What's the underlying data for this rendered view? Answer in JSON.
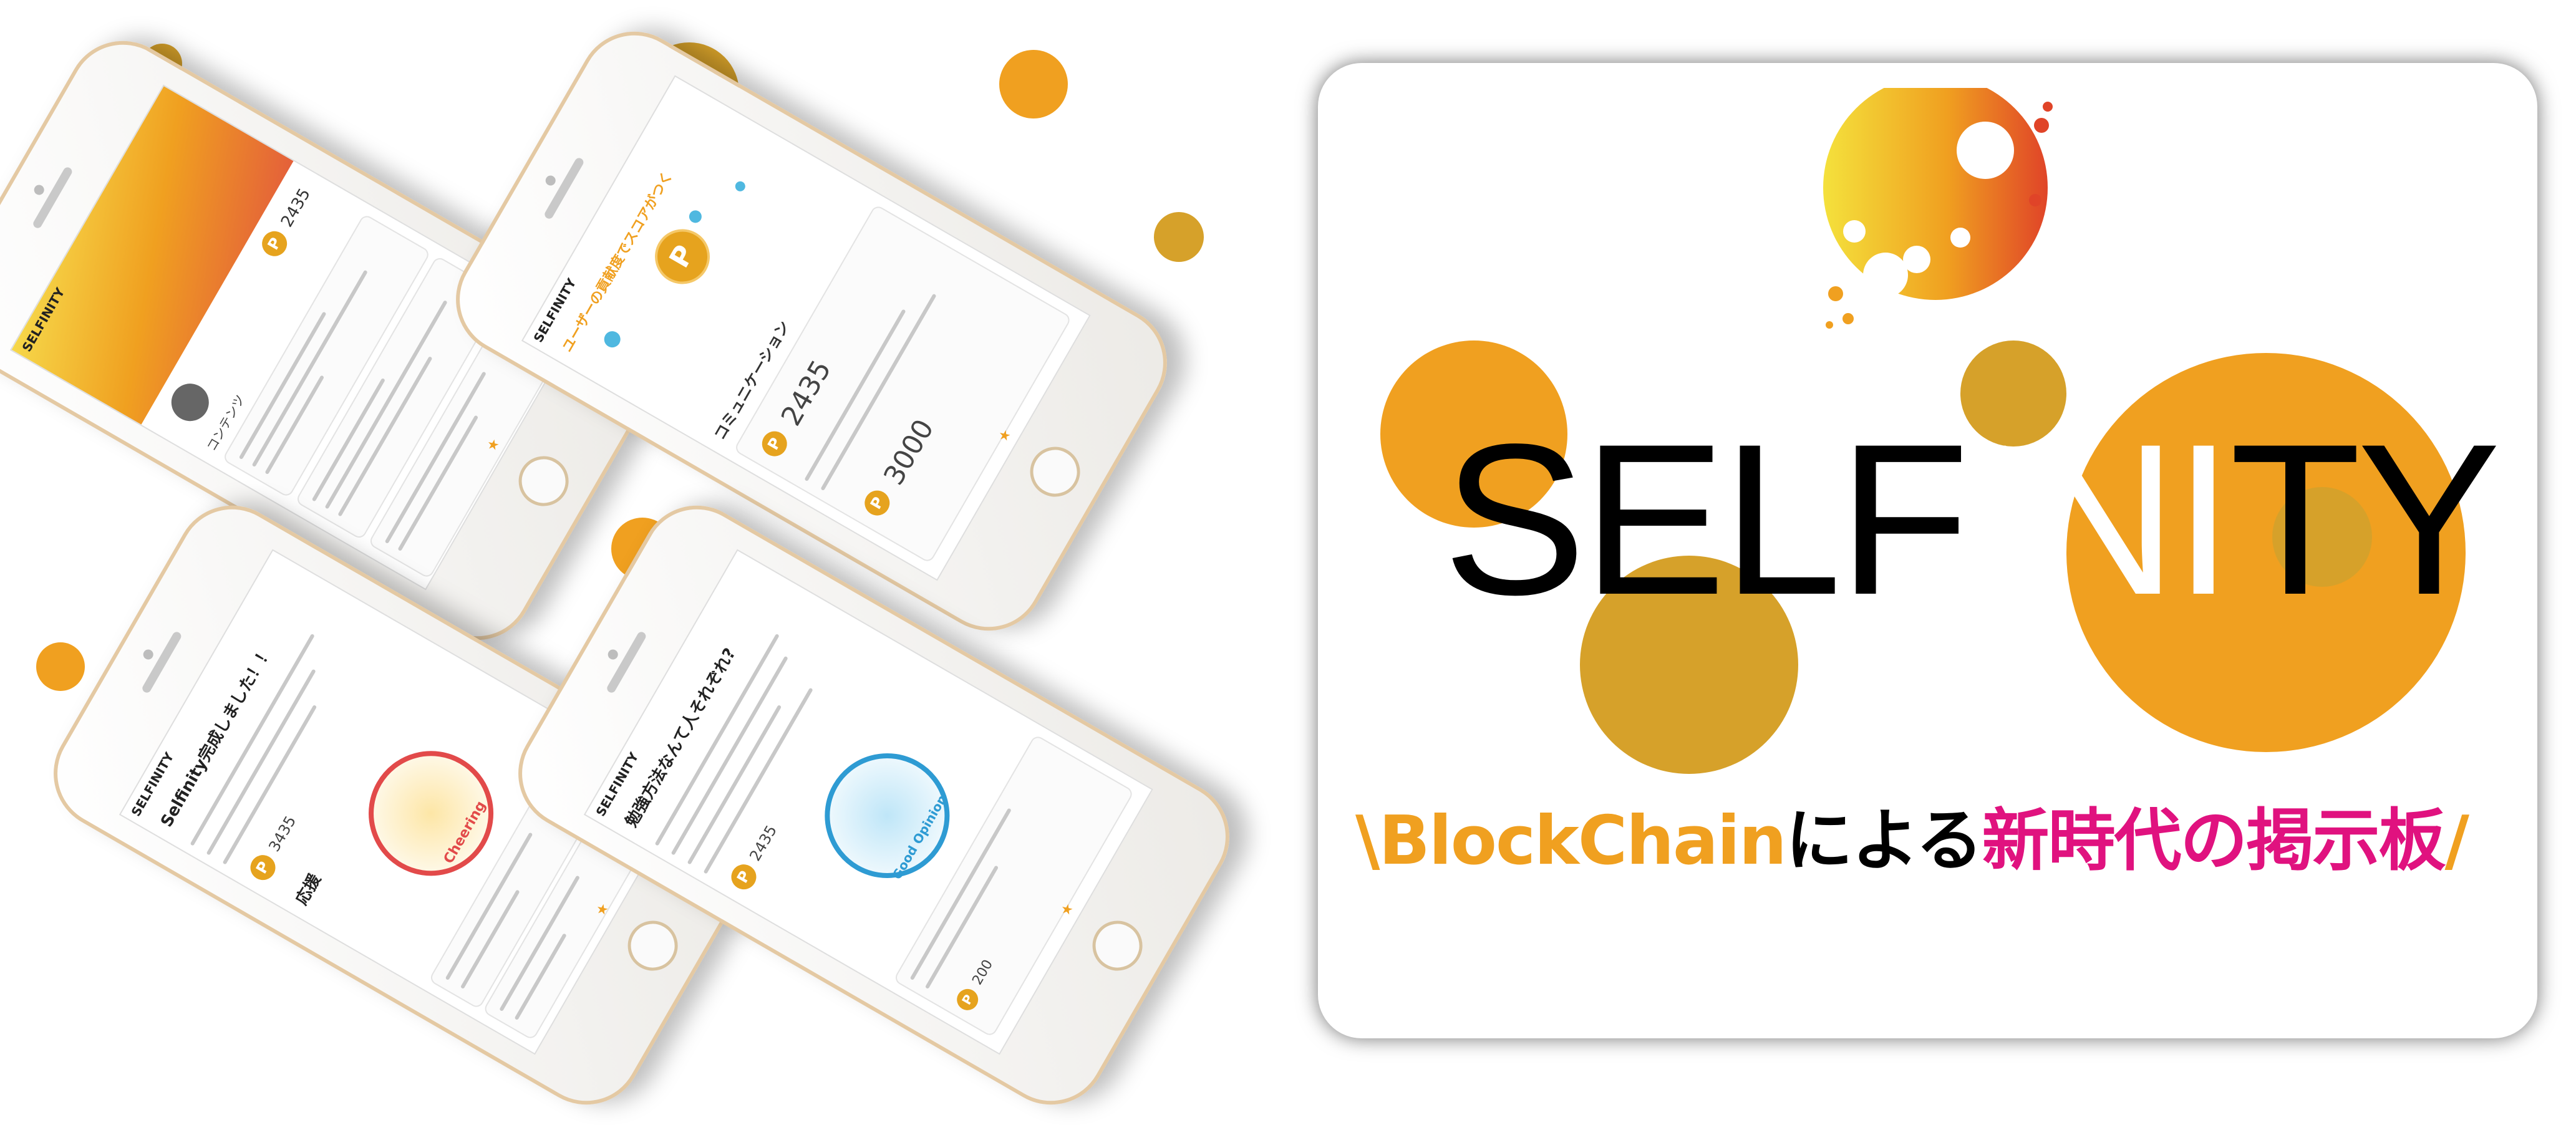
{
  "colors": {
    "orange": "#F0A020",
    "gold": "#D6A12A",
    "magenta": "#E0127F",
    "black": "#000000"
  },
  "logo": {
    "prefix": "SELF",
    "highlight": "INI",
    "suffix": "TY"
  },
  "tagline": {
    "slash_open": "\\",
    "brand": "BlockChain",
    "particle": "による",
    "phrase": "新時代の掲示板",
    "slash_close": "/"
  },
  "phones": [
    {
      "app_name": "SELFINITY",
      "score": "2435",
      "heading": "コンテンツ"
    },
    {
      "app_name": "SELFINITY",
      "heading": "ユーザーの貢献度でスコアがつく",
      "section": "コミュニケーション",
      "score": "2435",
      "score2": "3000"
    },
    {
      "app_name": "SELFINITY",
      "heading": "Selfinity完成しました！！",
      "score": "3435",
      "section": "応援",
      "stamp": "Cheering"
    },
    {
      "app_name": "SELFINITY",
      "heading": "勉強方法なんて人それぞれ?",
      "score": "2435",
      "stamp": "Good Opinion",
      "score2": "200"
    }
  ]
}
